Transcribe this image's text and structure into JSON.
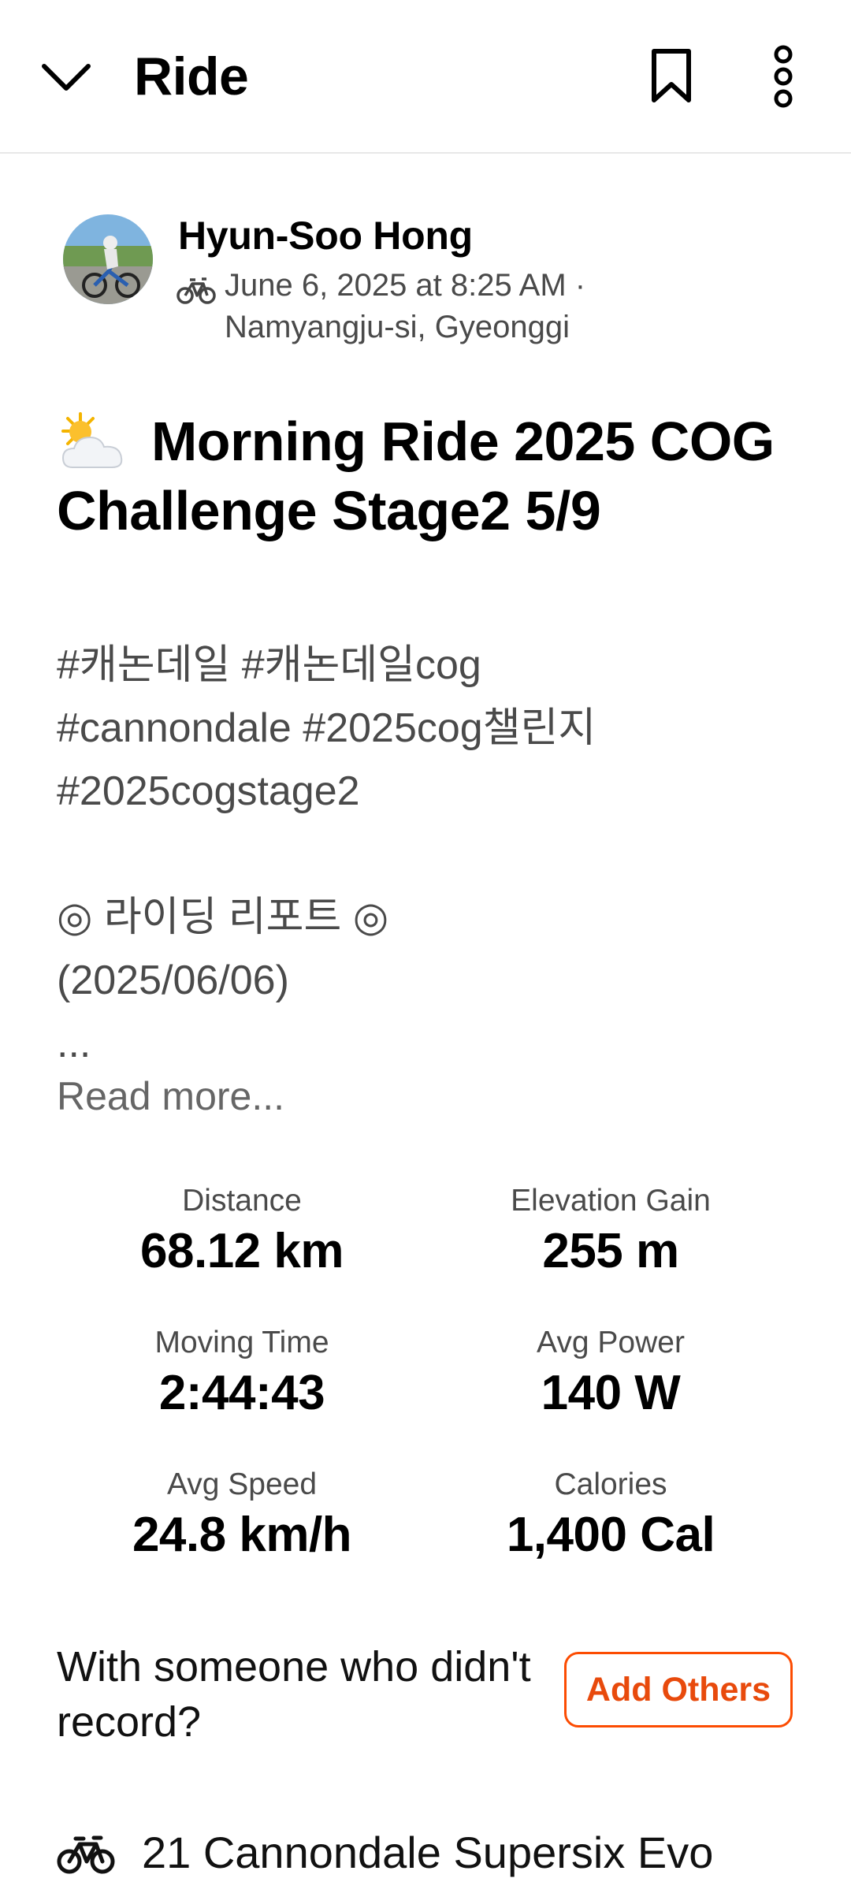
{
  "header": {
    "title": "Ride",
    "back_icon": "chevron-down-icon",
    "bookmark_icon": "bookmark-icon",
    "more_icon": "more-vertical-icon"
  },
  "athlete": {
    "name": "Hyun-Soo Hong",
    "activity_icon": "bike-icon",
    "datetime": "June 6, 2025 at 8:25 AM ·",
    "location": "Namyangju-si, Gyeonggi"
  },
  "activity": {
    "weather_icon": "sun-behind-cloud-icon",
    "title": "Morning Ride 2025 COG Challenge  Stage2 5/9",
    "description": "#캐논데일 #캐논데일cog\n#cannondale #2025cog챌린지\n#2025cogstage2\n\n◎ 라이딩 리포트 ◎\n(2025/06/06)\n...",
    "read_more": "Read more..."
  },
  "stats": [
    {
      "label": "Distance",
      "value": "68.12 km"
    },
    {
      "label": "Elevation Gain",
      "value": "255 m"
    },
    {
      "label": "Moving Time",
      "value": "2:44:43"
    },
    {
      "label": "Avg Power",
      "value": "140 W"
    },
    {
      "label": "Avg Speed",
      "value": "24.8 km/h"
    },
    {
      "label": "Calories",
      "value": "1,400 Cal"
    }
  ],
  "add_others": {
    "prompt": "With someone who didn't record?",
    "button_label": "Add Others"
  },
  "gear": {
    "icon": "bike-icon",
    "name": "21 Cannondale Supersix Evo"
  },
  "colors": {
    "accent": "#fc4c02",
    "text_primary": "#000000",
    "text_secondary": "#4a4a4a",
    "divider": "#e8e8e8"
  }
}
